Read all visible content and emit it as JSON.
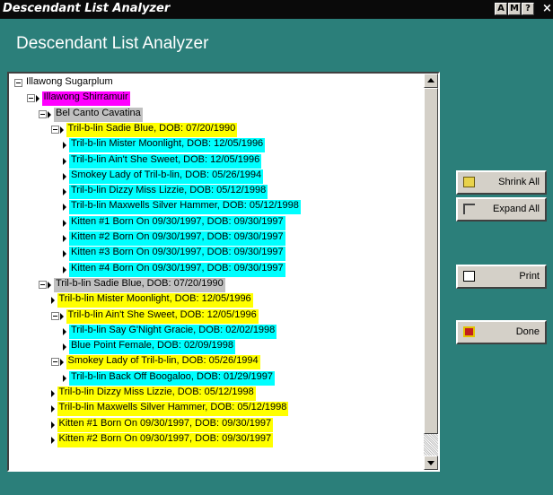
{
  "window": {
    "title": "Descendant List Analyzer",
    "buttons": [
      "A",
      "M",
      "?"
    ],
    "close_label": "×"
  },
  "header": {
    "title": "Descendant List Analyzer"
  },
  "tree": {
    "items": [
      {
        "label": "Illawong Sugarplum",
        "indent": 0,
        "kind": "expander",
        "highlight": "#ffffff"
      },
      {
        "label": "Illawong Shirramuir",
        "indent": 1,
        "kind": "expander-arrow",
        "highlight": "#ff00ff"
      },
      {
        "label": "Bel Canto Cavatina",
        "indent": 2,
        "kind": "expander-arrow",
        "highlight": "#c0c0c0"
      },
      {
        "label": "Tril-b-lin Sadie Blue, DOB: 07/20/1990",
        "indent": 3,
        "kind": "expander-arrow",
        "highlight": "#ffff00"
      },
      {
        "label": "Tril-b-lin Mister Moonlight, DOB: 12/05/1996",
        "indent": 4,
        "kind": "arrow",
        "highlight": "#00ffff"
      },
      {
        "label": "Tril-b-lin Ain't She Sweet, DOB: 12/05/1996",
        "indent": 4,
        "kind": "arrow",
        "highlight": "#00ffff"
      },
      {
        "label": "Smokey Lady of Tril-b-lin, DOB: 05/26/1994",
        "indent": 4,
        "kind": "arrow",
        "highlight": "#00ffff"
      },
      {
        "label": "Tril-b-lin Dizzy Miss Lizzie, DOB: 05/12/1998",
        "indent": 4,
        "kind": "arrow",
        "highlight": "#00ffff"
      },
      {
        "label": "Tril-b-lin Maxwells Silver Hammer, DOB: 05/12/1998",
        "indent": 4,
        "kind": "arrow",
        "highlight": "#00ffff"
      },
      {
        "label": "Kitten #1 Born On 09/30/1997, DOB: 09/30/1997",
        "indent": 4,
        "kind": "arrow",
        "highlight": "#00ffff"
      },
      {
        "label": "Kitten #2 Born On 09/30/1997, DOB: 09/30/1997",
        "indent": 4,
        "kind": "arrow",
        "highlight": "#00ffff"
      },
      {
        "label": "Kitten #3 Born On 09/30/1997, DOB: 09/30/1997",
        "indent": 4,
        "kind": "arrow",
        "highlight": "#00ffff"
      },
      {
        "label": "Kitten #4 Born On 09/30/1997, DOB: 09/30/1997",
        "indent": 4,
        "kind": "arrow",
        "highlight": "#00ffff"
      },
      {
        "label": "Tril-b-lin Sadie Blue, DOB: 07/20/1990",
        "indent": 2,
        "kind": "expander-arrow",
        "highlight": "#c0c0c0"
      },
      {
        "label": "Tril-b-lin Mister Moonlight, DOB: 12/05/1996",
        "indent": 3,
        "kind": "arrow",
        "highlight": "#ffff00"
      },
      {
        "label": "Tril-b-lin Ain't She Sweet, DOB: 12/05/1996",
        "indent": 3,
        "kind": "expander-arrow",
        "highlight": "#ffff00"
      },
      {
        "label": "Tril-b-lin Say G'Night Gracie, DOB: 02/02/1998",
        "indent": 4,
        "kind": "arrow",
        "highlight": "#00ffff"
      },
      {
        "label": "Blue Point Female, DOB: 02/09/1998",
        "indent": 4,
        "kind": "arrow",
        "highlight": "#00ffff"
      },
      {
        "label": "Smokey Lady of Tril-b-lin, DOB: 05/26/1994",
        "indent": 3,
        "kind": "expander-arrow",
        "highlight": "#ffff00"
      },
      {
        "label": "Tril-b-lin Back Off Boogaloo, DOB: 01/29/1997",
        "indent": 4,
        "kind": "arrow",
        "highlight": "#00ffff"
      },
      {
        "label": "Tril-b-lin Dizzy Miss Lizzie, DOB: 05/12/1998",
        "indent": 3,
        "kind": "arrow",
        "highlight": "#ffff00"
      },
      {
        "label": "Tril-b-lin Maxwells Silver Hammer, DOB: 05/12/1998",
        "indent": 3,
        "kind": "arrow",
        "highlight": "#ffff00"
      },
      {
        "label": "Kitten #1 Born On 09/30/1997, DOB: 09/30/1997",
        "indent": 3,
        "kind": "arrow",
        "highlight": "#ffff00"
      },
      {
        "label": "Kitten #2 Born On 09/30/1997, DOB: 09/30/1997",
        "indent": 3,
        "kind": "arrow",
        "highlight": "#ffff00"
      }
    ]
  },
  "buttons": {
    "shrink_all": "Shrink All",
    "expand_all": "Expand All",
    "print": "Print",
    "done": "Done"
  },
  "icons": {
    "shrink": "folder-icon",
    "expand": "tree-icon",
    "print": "printer-icon",
    "done": "door-icon"
  }
}
